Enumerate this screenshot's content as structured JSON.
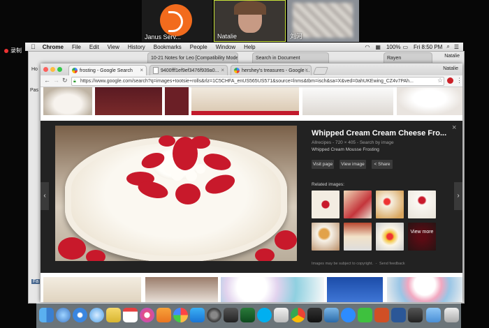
{
  "video_tiles": [
    {
      "name": "Janus Serv..."
    },
    {
      "name": "Natalie"
    },
    {
      "name": "刘河"
    }
  ],
  "recording_label": "录制",
  "menubar": {
    "items": [
      "Chrome",
      "File",
      "Edit",
      "View",
      "History",
      "Bookmarks",
      "People",
      "Window",
      "Help"
    ],
    "battery": "100%",
    "clock": "Fri 8:50 PM"
  },
  "back_window": {
    "tabs": [
      "10-21 Notes for Leo [Compatibility Mode]",
      "Search in Document",
      "Rayen"
    ],
    "user": "Natalie",
    "left_labels": [
      "Ho",
      "Pas",
      "Fa"
    ]
  },
  "front_window": {
    "user": "Natalie",
    "tabs": [
      {
        "label": "frosting - Google Search"
      },
      {
        "label": "9400fff1ef9ef3476f939a0..."
      },
      {
        "label": "hershey's treasures - Google ..."
      }
    ],
    "url": "https://www.google.com/search?q=images+tootsie+rolls&rlz=1C5CHFA_enUS565US571&source=lnms&tbm=isch&sa=X&ved=0ahUKEwing_CZ4v7PAh..."
  },
  "image_panel": {
    "title": "Whipped Cream Cream Cheese Fro...",
    "meta": "Allrecipes - 720 × 405 - Search by image",
    "caption": "Whipped Cream Mousse Frosting",
    "buttons": [
      "Visit page",
      "View image",
      "Share"
    ],
    "related_label": "Related images:",
    "view_more": "View more",
    "copyright": "Images may be subject to copyright.",
    "feedback": "Send feedback"
  },
  "colors": {
    "accent": "#4285f4",
    "panel_bg": "#222222",
    "strawberry": "#c8192b"
  }
}
